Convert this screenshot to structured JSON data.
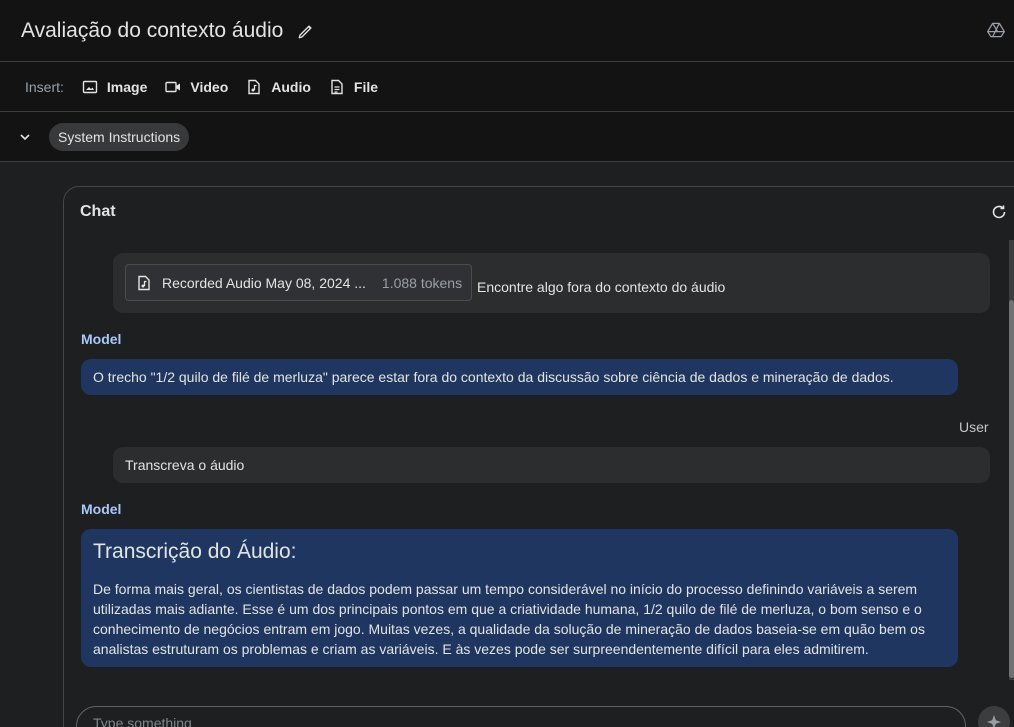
{
  "header": {
    "title": "Avaliação do contexto áudio"
  },
  "insert_bar": {
    "label": "Insert:",
    "buttons": [
      {
        "label": "Image",
        "icon": "image-icon"
      },
      {
        "label": "Video",
        "icon": "video-icon"
      },
      {
        "label": "Audio",
        "icon": "audio-file-icon"
      },
      {
        "label": "File",
        "icon": "file-icon"
      }
    ]
  },
  "system_instructions": {
    "label": "System Instructions"
  },
  "chat": {
    "title": "Chat",
    "input_placeholder": "Type something",
    "messages": [
      {
        "role": "User",
        "attachment": {
          "name": "Recorded Audio May 08, 2024 ...",
          "tokens": "1.088 tokens"
        },
        "text": "Encontre algo fora do contexto do áudio"
      },
      {
        "role": "Model",
        "text": "O trecho \"1/2 quilo de filé de merluza\" parece estar fora do contexto da discussão sobre ciência de dados e mineração de dados."
      },
      {
        "role": "User",
        "text": "Transcreva o áudio"
      },
      {
        "role": "Model",
        "heading": "Transcrição do Áudio:",
        "text": "De forma mais geral, os cientistas de dados podem passar um tempo considerável no início do processo definindo variáveis a serem utilizadas mais adiante. Esse é um dos principais pontos em que a criatividade humana, 1/2 quilo de filé de merluza, o bom senso e o conhecimento de negócios entram em jogo. Muitas vezes, a qualidade da solução de mineração de dados baseia-se em quão bem os analistas estruturam os problemas e criam as variáveis. E às vezes pode ser surpreendentemente difícil para eles admitirem."
      }
    ]
  },
  "colors": {
    "background": "#1e1f20",
    "model_bubble": "#1f3760",
    "user_bubble": "#2c2d2f",
    "model_label": "#a8c7fa"
  }
}
